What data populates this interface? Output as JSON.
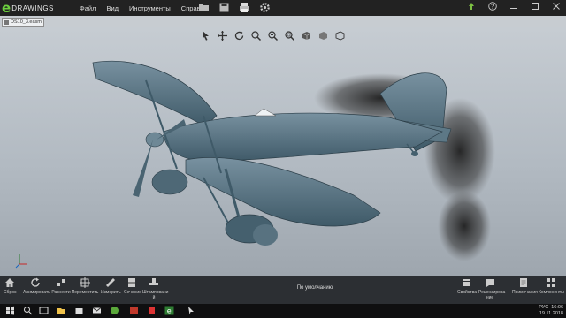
{
  "app": {
    "logo_letter": "e",
    "logo_word": "DRAWINGS"
  },
  "menu": {
    "items": [
      "Файл",
      "Вид",
      "Инструменты",
      "Справка"
    ]
  },
  "document": {
    "tab_name": "DS10_3.easm"
  },
  "toolbar_bottom": {
    "buttons": [
      {
        "label": "Сброс",
        "icon": "home-icon"
      },
      {
        "label": "Анимировать",
        "icon": "animate-icon"
      },
      {
        "label": "Разнести",
        "icon": "explode-icon"
      },
      {
        "label": "Переместить",
        "icon": "move-icon"
      },
      {
        "label": "Измерить",
        "icon": "measure-icon"
      },
      {
        "label": "Сечение",
        "icon": "section-icon"
      },
      {
        "label": "Штамповани\nй",
        "icon": "stamp-icon"
      }
    ],
    "center_label": "По умолчанию",
    "right_buttons": [
      {
        "label": "Свойства",
        "icon": "properties-icon"
      },
      {
        "label": "Рецензирова\nние",
        "icon": "review-icon"
      },
      {
        "label": "Примечания",
        "icon": "notes-icon"
      },
      {
        "label": "Компоненты",
        "icon": "components-icon"
      }
    ]
  },
  "taskbar": {
    "language": "РУС",
    "time": "16:06",
    "date": "19.11.2018"
  },
  "colors": {
    "accent_green": "#6ccf3f",
    "model": "#4f6b78",
    "titlebar": "#222222",
    "bottombar": "#2c2f33"
  }
}
